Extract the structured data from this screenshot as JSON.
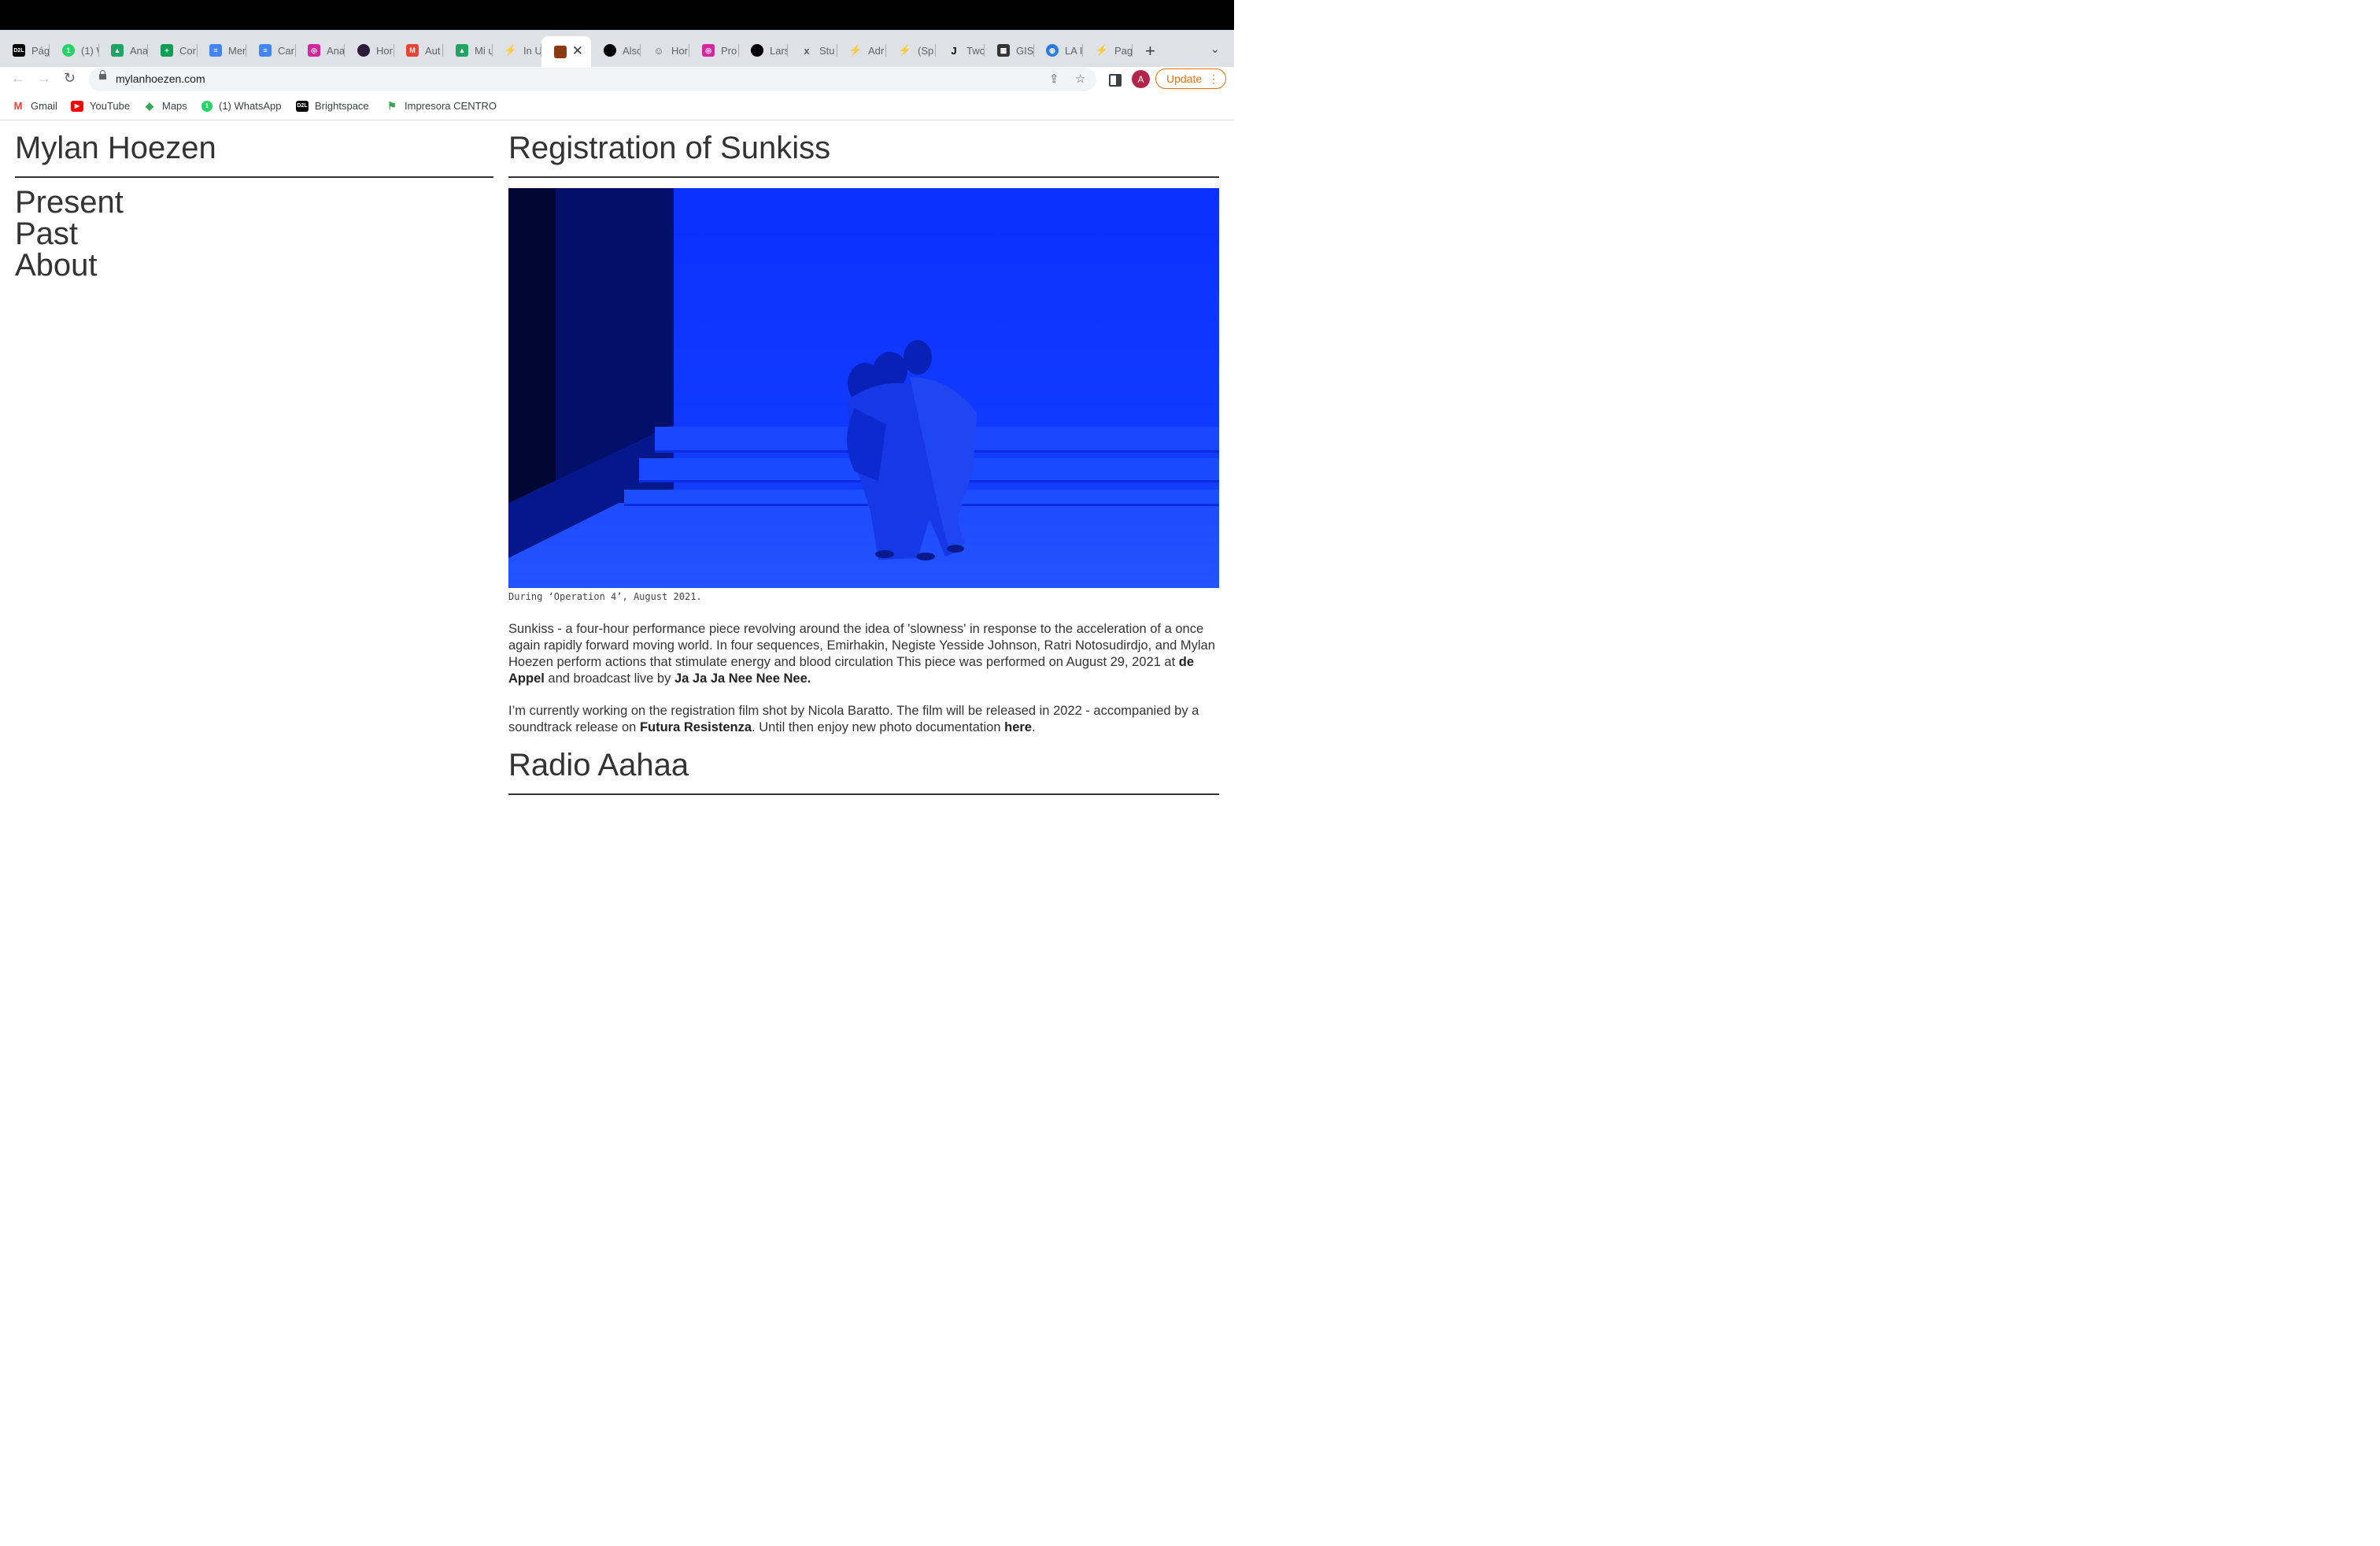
{
  "browser": {
    "tabs": [
      {
        "title": "Pág",
        "icon": "d2l-icon",
        "color": "#000000"
      },
      {
        "title": "(1) W",
        "icon": "whatsapp-icon",
        "color": "#25d366"
      },
      {
        "title": "Ana",
        "icon": "google-drive-icon",
        "color": "#1fa463"
      },
      {
        "title": "Cor",
        "icon": "google-sheets-icon",
        "color": "#0f9d58"
      },
      {
        "title": "Mer",
        "icon": "google-docs-icon",
        "color": "#4285f4"
      },
      {
        "title": "Car",
        "icon": "google-docs-icon",
        "color": "#4285f4"
      },
      {
        "title": "Ana",
        "icon": "instagram-icon",
        "color": "#d6249f"
      },
      {
        "title": "Hor",
        "icon": "dark-circle-icon",
        "color": "#2d1b3d"
      },
      {
        "title": "Aut",
        "icon": "gmail-icon",
        "color": "#ea4335"
      },
      {
        "title": "Mi u",
        "icon": "google-drive-icon",
        "color": "#1fa463"
      },
      {
        "title": "In U",
        "icon": "bolt-icon",
        "color": "#202124"
      },
      {
        "title": "",
        "icon": "photo-thumbnail-icon",
        "color": "#8a3b12"
      },
      {
        "title": "Also",
        "icon": "black-circle-icon",
        "color": "#000000"
      },
      {
        "title": "Hor",
        "icon": "smiley-icon",
        "color": "#5f6368"
      },
      {
        "title": "Pro",
        "icon": "instagram-icon",
        "color": "#d6249f"
      },
      {
        "title": "Lars",
        "icon": "black-circle-icon",
        "color": "#000000"
      },
      {
        "title": "Stu",
        "icon": "x-small-icon",
        "color": "#5f6368"
      },
      {
        "title": "Adr",
        "icon": "bolt-icon",
        "color": "#202124"
      },
      {
        "title": "(Sp",
        "icon": "bolt-icon",
        "color": "#202124"
      },
      {
        "title": "Two",
        "icon": "j-letter-icon",
        "color": "#000000"
      },
      {
        "title": "GIS",
        "icon": "pixel-logo-icon",
        "color": "#333333"
      },
      {
        "title": "LA I",
        "icon": "globe-icon",
        "color": "#2a7ae2"
      },
      {
        "title": "Pag",
        "icon": "bolt-icon",
        "color": "#202124"
      }
    ],
    "active_tab_index": 11,
    "url": "mylanhoezen.com",
    "update_label": "Update",
    "avatar_letter": "A",
    "bookmarks": [
      {
        "label": "Gmail",
        "icon": "gmail-icon",
        "color": "#ea4335"
      },
      {
        "label": "YouTube",
        "icon": "youtube-icon",
        "color": "#ff0000"
      },
      {
        "label": "Maps",
        "icon": "maps-icon",
        "color": "#34a853"
      },
      {
        "label": "(1) WhatsApp",
        "icon": "whatsapp-icon",
        "color": "#25d366"
      },
      {
        "label": "Brightspace",
        "icon": "d2l-icon",
        "color": "#000000"
      },
      {
        "label": "Impresora CENTRO",
        "icon": "flag-icon",
        "color": "#34a853"
      }
    ]
  },
  "site": {
    "title": "Mylan Hoezen",
    "nav": [
      "Present",
      "Past",
      "About"
    ]
  },
  "post": {
    "title": "Registration of Sunkiss",
    "caption": "During ‘Operation 4’, August 2021.",
    "p1": {
      "text": "Sunkiss - a four-hour performance piece revolving around the idea of 'slowness' in response to the acceleration of a once again rapidly forward moving world. In four sequences, Emirhakin, Negiste Yesside Johnson, Ratri Notosudirdjo, and Mylan Hoezen perform actions that stimulate energy and blood circulation This piece was performed on August 29, 2021 at ",
      "link1": "de Appel",
      "mid": " and broadcast live by ",
      "link2": "Ja Ja Ja Nee Nee Nee."
    },
    "p2": {
      "text": "I’m currently working on the registration film shot by Nicola Baratto. The film will be released in 2022 - accompanied by a soundtrack release on ",
      "link1": "Futura Resistenza",
      "mid": ". Until then enjoy new photo documentation ",
      "link2": "here",
      "end": "."
    }
  },
  "next_post": {
    "title": "Radio Aahaa"
  }
}
